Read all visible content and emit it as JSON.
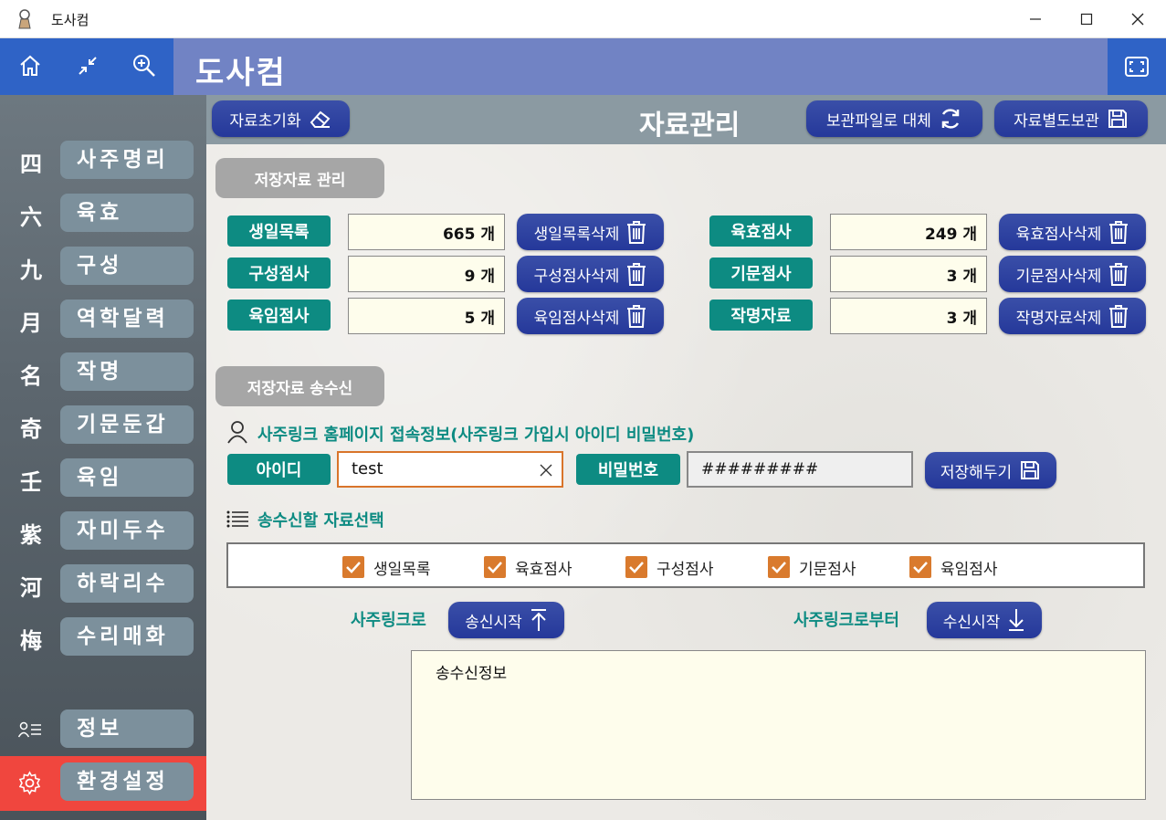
{
  "window": {
    "title": "도사컴",
    "controls": {
      "minimize": "—",
      "maximize": "☐",
      "close": "✕"
    }
  },
  "header": {
    "app_name": "도사컴",
    "icons": [
      "home-icon",
      "collapse-icon",
      "zoom-in-icon",
      "fullscreen-icon"
    ]
  },
  "sidebar": {
    "items": [
      {
        "hanja": "四",
        "label": "사주명리"
      },
      {
        "hanja": "六",
        "label": "육효"
      },
      {
        "hanja": "九",
        "label": "구성"
      },
      {
        "hanja": "月",
        "label": "역학달력"
      },
      {
        "hanja": "名",
        "label": "작명"
      },
      {
        "hanja": "奇",
        "label": "기문둔갑"
      },
      {
        "hanja": "壬",
        "label": "육임"
      },
      {
        "hanja": "紫",
        "label": "자미두수"
      },
      {
        "hanja": "河",
        "label": "하락리수"
      },
      {
        "hanja": "梅",
        "label": "수리매화"
      }
    ],
    "info_label": "정보",
    "settings_label": "환경설정"
  },
  "toolbar": {
    "reset_label": "자료초기화",
    "title": "자료관리",
    "replace_label": "보관파일로 대체",
    "backup_label": "자료별도보관"
  },
  "storage": {
    "section_label": "저장자료 관리",
    "left": [
      {
        "name": "생일목록",
        "count": "665 개",
        "delete_label": "생일목록삭제"
      },
      {
        "name": "구성점사",
        "count": "9 개",
        "delete_label": "구성점사삭제"
      },
      {
        "name": "육임점사",
        "count": "5 개",
        "delete_label": "육임점사삭제"
      }
    ],
    "right": [
      {
        "name": "육효점사",
        "count": "249 개",
        "delete_label": "육효점사삭제"
      },
      {
        "name": "기문점사",
        "count": "3 개",
        "delete_label": "기문점사삭제"
      },
      {
        "name": "작명자료",
        "count": "3 개",
        "delete_label": "작명자료삭제"
      }
    ]
  },
  "transfer": {
    "section_label": "저장자료 송수신",
    "account_heading": "사주링크 홈페이지 접속정보(사주링크 가입시 아이디 비밀번호)",
    "id_label": "아이디",
    "id_value": "test",
    "pw_label": "비밀번호",
    "pw_value": "#########",
    "save_label": "저장해두기",
    "select_heading": "송수신할 자료선택",
    "options": [
      {
        "label": "생일목록",
        "checked": true
      },
      {
        "label": "육효점사",
        "checked": true
      },
      {
        "label": "구성점사",
        "checked": true
      },
      {
        "label": "기문점사",
        "checked": true
      },
      {
        "label": "육임점사",
        "checked": true
      }
    ],
    "to_label": "사주링크로",
    "send_label": "송신시작",
    "from_label": "사주링크로부터",
    "receive_label": "수신시작",
    "log_text": "송수신정보"
  },
  "colors": {
    "teal": "#0d8b82",
    "button_blue": "#25389a",
    "header_blue": "#2f63c6",
    "header_main": "#7183c4",
    "settings_red": "#f0463e",
    "checkbox_orange": "#d97a2d"
  }
}
